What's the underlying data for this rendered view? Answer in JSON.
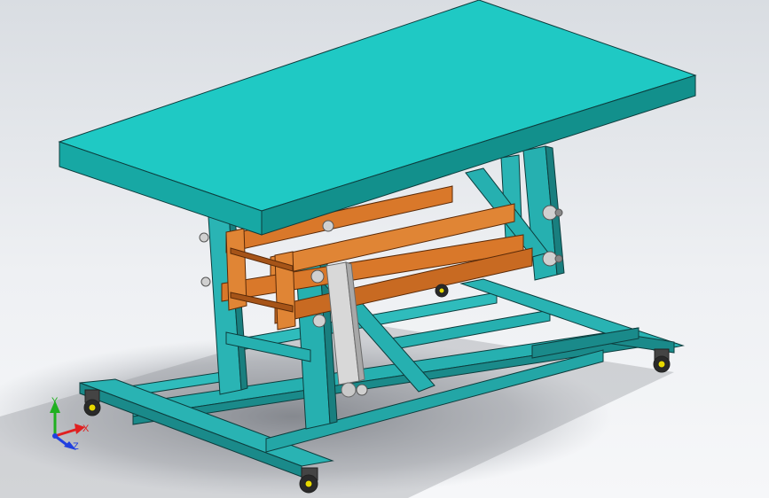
{
  "viewport": {
    "background_top": "#d9dde2",
    "background_bottom": "#f6f7f9"
  },
  "model": {
    "frame_color": "#26b0b0",
    "top_color": "#1fc9c4",
    "scissor_color": "#d9782a",
    "cylinder_color": "#d8d8d8",
    "wheel_color": "#e6d800"
  },
  "triad": {
    "x_label": "X",
    "y_label": "Y",
    "z_label": "Z",
    "x_color": "#e02020",
    "y_color": "#20b020",
    "z_color": "#2040e0"
  }
}
